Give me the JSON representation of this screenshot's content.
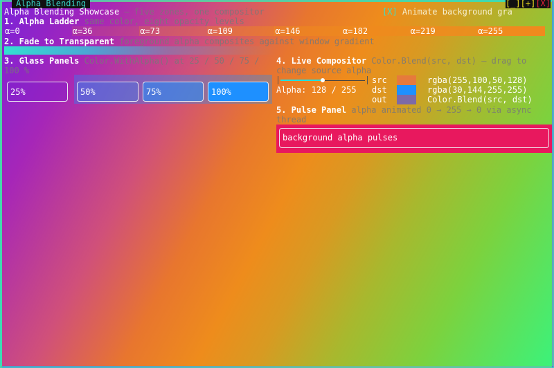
{
  "window": {
    "tab_title": "Alpha Blending",
    "controls": [
      "[_]",
      "[+]",
      "[X]"
    ]
  },
  "header": {
    "title": "Alpha Blending Showcase",
    "subtitle": "— five zones, one compositor",
    "animate_checkbox": "[X]",
    "animate_label": "Animate background gra",
    "animate_checked": true
  },
  "ladder": {
    "title": "1. Alpha Ladder",
    "desc": "same color, eight opacity levels",
    "color": "#f08a1e",
    "levels": [
      "α=0",
      "α=36",
      "α=73",
      "α=109",
      "α=146",
      "α=182",
      "α=219",
      "α=255"
    ]
  },
  "fade": {
    "title": "2. Fade to Transparent",
    "desc": "foreground alpha composites against window gradient"
  },
  "glass": {
    "title": "3. Glass Panels",
    "desc": "Color.WithAlpha() at 25 / 50 / 75 /",
    "desc2": "100 %",
    "panels": [
      "25%",
      "50%",
      "75%",
      "100%"
    ]
  },
  "compositor": {
    "title": "4. Live Compositor",
    "desc": "Color.Blend(src, dst) — drag to",
    "desc2": "change source alpha",
    "alpha_value": 128,
    "alpha_label": "Alpha: 128 / 255",
    "rows": [
      {
        "label": "src",
        "value": "rgba(255,100,50,128)",
        "color": "#e67a3c"
      },
      {
        "label": "dst",
        "value": "rgba(30,144,255,255)",
        "color": "#1e90ff"
      },
      {
        "label": "out",
        "value": "Color.Blend(src, dst)",
        "color": "#7d6aa8"
      }
    ]
  },
  "pulse": {
    "title": "5. Pulse Panel",
    "desc": "alpha animated 0 → 255 → 0 via async",
    "desc2": "thread",
    "label": "background alpha pulses",
    "color": "#e8185e"
  }
}
